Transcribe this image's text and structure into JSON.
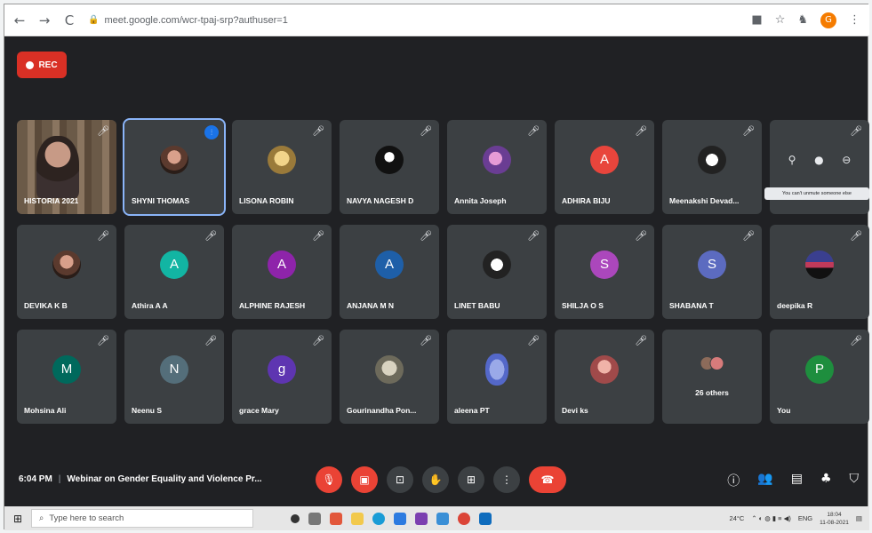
{
  "browser": {
    "url": "meet.google.com/wcr-tpaj-srp?authuser=1",
    "back_icon": "←",
    "forward_icon": "→",
    "reload_icon": "C",
    "profile_initial": "G"
  },
  "meeting": {
    "rec_label": "REC",
    "time": "6:04 PM",
    "separator": "|",
    "title": "Webinar on Gender Equality and Violence Pr...",
    "tooltip": "You can't unmute someone else"
  },
  "participants": [
    {
      "name": "HISTORIA 2021",
      "avatar_type": "video"
    },
    {
      "name": "SHYNI THOMAS",
      "avatar_type": "photo"
    },
    {
      "name": "LISONA ROBIN",
      "avatar_type": "photo2"
    },
    {
      "name": "NAVYA NAGESH D",
      "avatar_type": "photo3"
    },
    {
      "name": "Annita Joseph",
      "avatar_type": "photo4"
    },
    {
      "name": "ADHIRA BIJU",
      "initial": "A",
      "color": "#e8453c"
    },
    {
      "name": "Meenakshi Devad...",
      "avatar_type": "photo5"
    },
    {
      "name": "",
      "avatar_type": "pinned"
    },
    {
      "name": "DEVIKA K B",
      "avatar_type": "photo"
    },
    {
      "name": "Athira A A",
      "initial": "A",
      "color": "#12b5a3"
    },
    {
      "name": "ALPHINE RAJESH",
      "initial": "A",
      "color": "#8e24aa"
    },
    {
      "name": "ANJANA M N",
      "initial": "A",
      "color": "#1e5fa8"
    },
    {
      "name": "LINET BABU",
      "avatar_type": "photo5"
    },
    {
      "name": "SHILJA O S",
      "initial": "S",
      "color": "#ab47bc"
    },
    {
      "name": "SHABANA T",
      "initial": "S",
      "color": "#5c6bc0"
    },
    {
      "name": "deepika R",
      "avatar_type": "photo6"
    },
    {
      "name": "Mohsina Ali",
      "initial": "M",
      "color": "#00695c"
    },
    {
      "name": "Neenu S",
      "initial": "N",
      "color": "#546e7a"
    },
    {
      "name": "grace Mary",
      "initial": "g",
      "color": "#5e35b1"
    },
    {
      "name": "Gourinandha Pon...",
      "avatar_type": "photo7"
    },
    {
      "name": "aleena PT",
      "avatar_type": "photo8"
    },
    {
      "name": "Devi ks",
      "avatar_type": "photo9"
    },
    {
      "name": "26 others",
      "avatar_type": "others"
    },
    {
      "name": "You",
      "initial": "P",
      "color": "#1e8e3e"
    }
  ],
  "taskbar": {
    "search_placeholder": "Type here to search",
    "temperature": "24°C",
    "language": "ENG",
    "time": "18:04",
    "date": "11-08-2021"
  }
}
